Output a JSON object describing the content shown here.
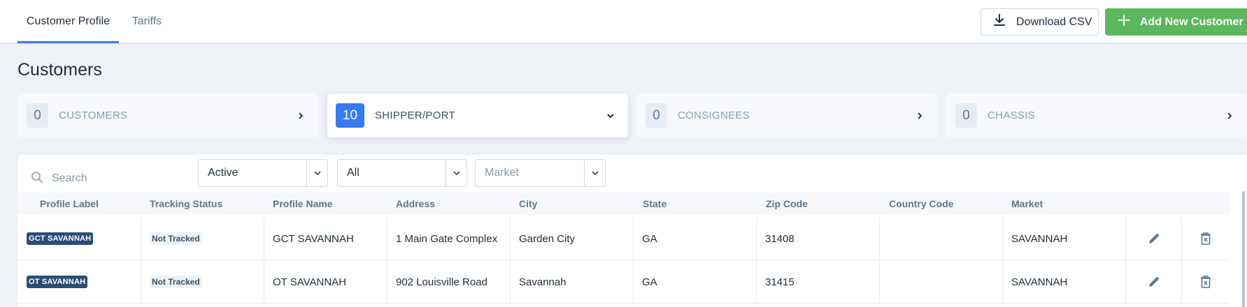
{
  "tabs": [
    {
      "label": "Customer Profile",
      "active": true
    },
    {
      "label": "Tariffs",
      "active": false
    }
  ],
  "toolbar": {
    "download_label": "Download CSV",
    "add_label": "Add New Customer"
  },
  "page_title": "Customers",
  "cards": [
    {
      "count": "0",
      "label": "CUSTOMERS",
      "icon": "chevron-right-icon"
    },
    {
      "count": "10",
      "label": "SHIPPER/PORT",
      "icon": "chevron-down-icon"
    },
    {
      "count": "0",
      "label": "CONSIGNEES",
      "icon": "chevron-right-icon"
    },
    {
      "count": "0",
      "label": "CHASSIS",
      "icon": "chevron-right-icon"
    }
  ],
  "filters": {
    "search_placeholder": "Search",
    "status_value": "Active",
    "type_value": "All",
    "market_placeholder": "Market"
  },
  "table": {
    "columns": [
      "Profile Label",
      "Tracking Status",
      "Profile Name",
      "Address",
      "City",
      "State",
      "Zip Code",
      "Country Code",
      "Market"
    ],
    "rows": [
      {
        "label": "GCT SAVANNAH",
        "tracking": "Not Tracked",
        "name": "GCT SAVANNAH",
        "address": "1 Main Gate Complex",
        "city": "Garden City",
        "state": "GA",
        "zip": "31408",
        "country": "",
        "market": "SAVANNAH"
      },
      {
        "label": "OT SAVANNAH",
        "tracking": "Not Tracked",
        "name": "OT SAVANNAH",
        "address": "902 Louisville Road",
        "city": "Savannah",
        "state": "GA",
        "zip": "31415",
        "country": "",
        "market": "SAVANNAH"
      }
    ]
  },
  "colors": {
    "accent": "#367bf6",
    "success": "#5cb85c",
    "label_badge": "#2b4c78"
  }
}
